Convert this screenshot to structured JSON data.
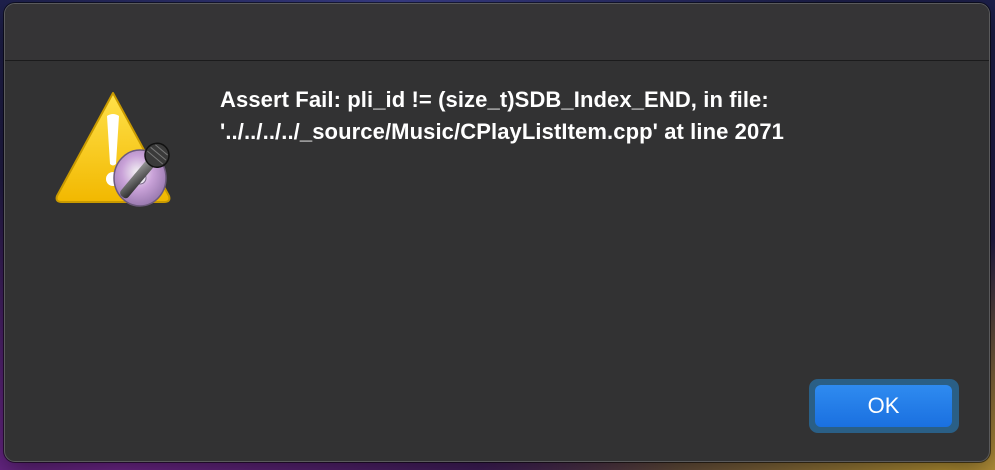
{
  "dialog": {
    "message_line1": "Assert Fail: pli_id != (size_t)SDB_Index_END, in file:",
    "message_line2": "'../../../../_source/Music/CPlayListItem.cpp' at line 2071",
    "icon": "warning-microphone-icon",
    "ok_label": "OK"
  },
  "colors": {
    "dialog_bg": "#323233",
    "accent": "#1a70e0",
    "warning": "#f5c400"
  }
}
